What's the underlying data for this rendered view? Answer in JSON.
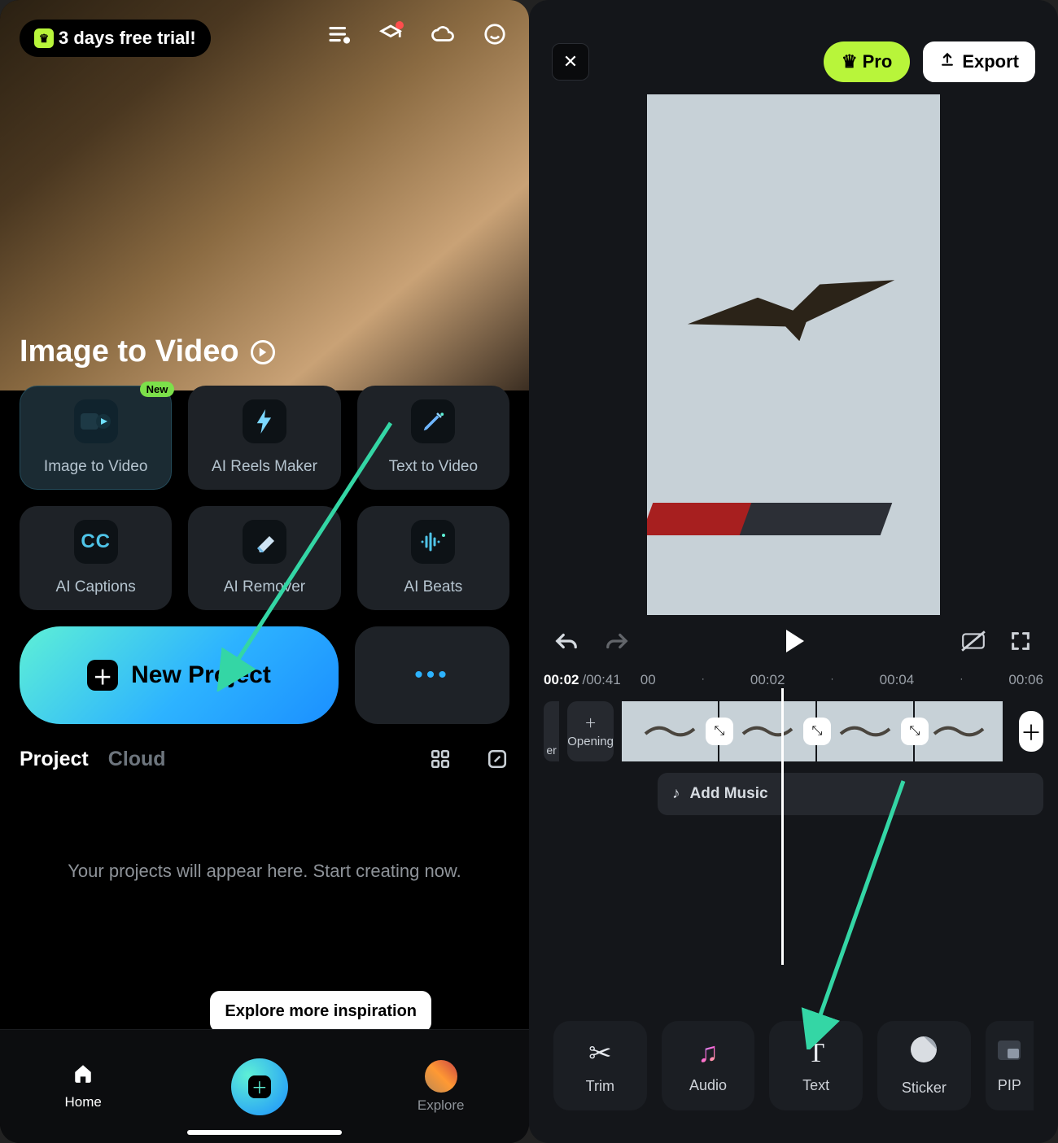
{
  "left": {
    "trial_label": "3 days free trial!",
    "hero_title": "Image to Video",
    "tools": {
      "image_to_video": {
        "label": "Image to Video",
        "badge": "New"
      },
      "ai_reels": {
        "label": "AI Reels Maker"
      },
      "text_to_video": {
        "label": "Text  to Video"
      },
      "ai_captions": {
        "label": "AI Captions",
        "icon_text": "CC"
      },
      "ai_remover": {
        "label": "AI Remover"
      },
      "ai_beats": {
        "label": "AI Beats"
      }
    },
    "new_project_label": "New Project",
    "tabs": {
      "project": "Project",
      "cloud": "Cloud"
    },
    "empty_state": "Your projects will appear here. Start creating now.",
    "nav": {
      "home": "Home",
      "explore": "Explore"
    },
    "explore_tip": "Explore more inspiration"
  },
  "right": {
    "pro_label": "Pro",
    "export_label": "Export",
    "time_current": "00:02",
    "time_total": "/00:41",
    "ticks": [
      "00",
      "·",
      "00:02",
      "·",
      "00:04",
      "·",
      "00:06"
    ],
    "opening_label": "Opening",
    "stub_label": "er",
    "add_music_label": "Add Music",
    "tray": {
      "trim": "Trim",
      "audio": "Audio",
      "text": "Text",
      "sticker": "Sticker",
      "pip": "PIP"
    }
  }
}
